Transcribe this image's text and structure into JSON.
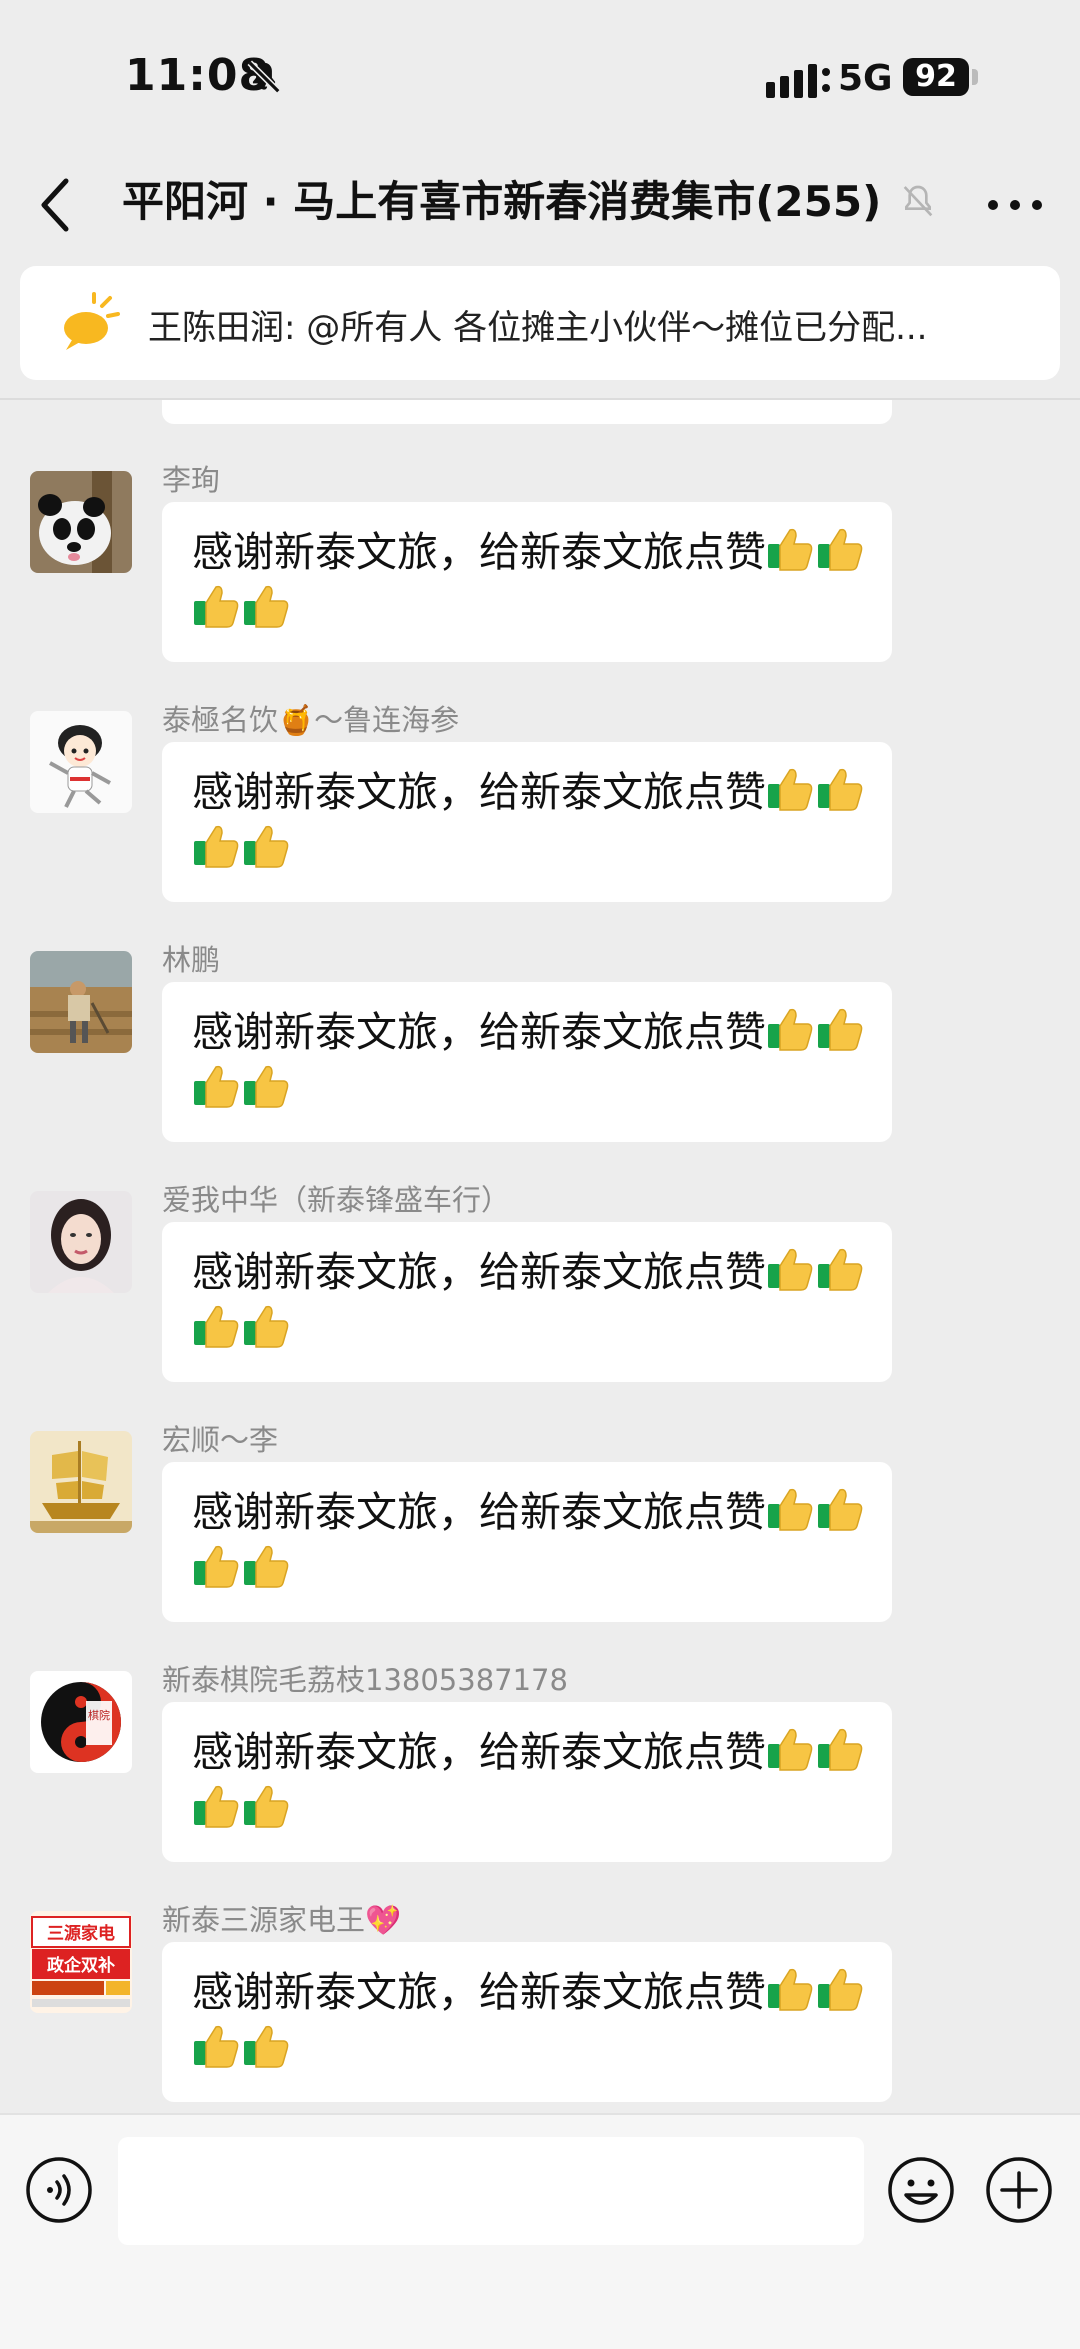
{
  "status_bar": {
    "time": "11:08",
    "network": "5G",
    "battery": "92"
  },
  "header": {
    "title": "平阳河 · 马上有喜市新春消费集市(255)"
  },
  "notice": {
    "text": "王陈田润: @所有人  各位摊主小伙伴～摊位已分配..."
  },
  "messages": [
    {
      "sender": "李珣",
      "text": "感谢新泰文旅，给新泰文旅点赞",
      "thumbs": 4
    },
    {
      "sender": "泰極名饮🍯～鲁连海参",
      "text": "感谢新泰文旅，给新泰文旅点赞",
      "thumbs": 4
    },
    {
      "sender": "林鹏",
      "text": "感谢新泰文旅，给新泰文旅点赞",
      "thumbs": 4
    },
    {
      "sender": "爱我中华（新泰锋盛车行）",
      "text": "感谢新泰文旅，给新泰文旅点赞",
      "thumbs": 4
    },
    {
      "sender": "宏顺～李",
      "text": "感谢新泰文旅，给新泰文旅点赞",
      "thumbs": 4
    },
    {
      "sender": "新泰棋院毛荔枝13805387178",
      "text": "感谢新泰文旅，给新泰文旅点赞",
      "thumbs": 4
    },
    {
      "sender": "新泰三源家电王💖",
      "text": "感谢新泰文旅，给新泰文旅点赞",
      "thumbs": 4
    }
  ],
  "avatars": {
    "m1": {
      "icon": "panda-avatar-icon"
    },
    "m2": {
      "icon": "cartoon-girl-avatar-icon"
    },
    "m3": {
      "icon": "farmer-field-avatar-icon"
    },
    "m4": {
      "icon": "woman-portrait-avatar-icon"
    },
    "m5": {
      "icon": "golden-ship-avatar-icon"
    },
    "m6": {
      "text": "棋院",
      "icon": "yin-yang-avatar-icon"
    },
    "m7": {
      "line1": "三源家电",
      "line2": "政企双补",
      "icon": "store-sign-avatar-icon"
    }
  },
  "input": {
    "value": ""
  },
  "colors": {
    "background": "#ededed",
    "bubble": "#ffffff",
    "thumb": "#f7c544",
    "sleeve": "#17a34a"
  }
}
